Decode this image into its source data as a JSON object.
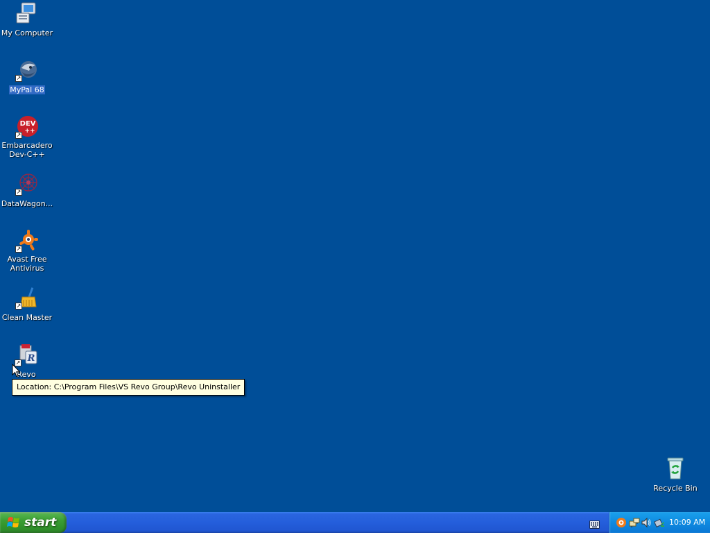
{
  "desktop": {
    "background_color": "#004e98",
    "icons": [
      {
        "label": "My Computer",
        "icon": "my-computer-icon",
        "selected": false
      },
      {
        "label": "MyPal 68",
        "icon": "mypal-browser-icon",
        "selected": true
      },
      {
        "label": "Embarcadero Dev-C++",
        "icon": "dev-cpp-icon",
        "selected": false
      },
      {
        "label": "DataWagon...",
        "icon": "datawagon-icon",
        "selected": false
      },
      {
        "label": "Avast Free Antivirus",
        "icon": "avast-icon",
        "selected": false
      },
      {
        "label": "Clean Master",
        "icon": "clean-master-icon",
        "selected": false
      },
      {
        "label": "Revo",
        "icon": "revo-uninstaller-icon",
        "selected": false
      },
      {
        "label": "Recycle Bin",
        "icon": "recycle-bin-icon",
        "selected": false
      }
    ]
  },
  "tooltip": {
    "text": "Location: C:\\Program Files\\VS Revo Group\\Revo Uninstaller"
  },
  "taskbar": {
    "start_label": "start",
    "tray_icons": [
      "avast-tray-icon",
      "network-tray-icon",
      "volume-tray-icon",
      "safely-remove-tray-icon"
    ],
    "clock": "10:09 AM",
    "colors": {
      "taskbar": "#245edb",
      "start_button": "#3a9e33",
      "tray": "#0f8ae0"
    }
  }
}
